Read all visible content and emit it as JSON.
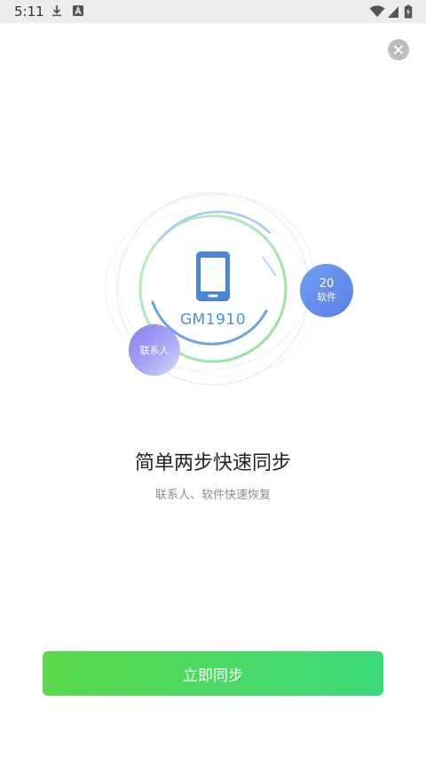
{
  "status_bar": {
    "time": "5:11",
    "left_icons": [
      "download-icon",
      "a-icon"
    ],
    "right_icons": [
      "wifi-icon",
      "signal-icon",
      "battery-charging-icon"
    ]
  },
  "close": {
    "icon": "close-icon"
  },
  "illustration": {
    "device_name": "GM1910",
    "apps_count": "20",
    "apps_label": "软件",
    "contacts_label": "联系人",
    "phone_icon": "phone-icon",
    "accent_color": "#4a90e2",
    "ring_green": "#8ee29b",
    "ring_blue": "#6ea3e8"
  },
  "content": {
    "title": "简单两步快速同步",
    "subtitle": "联系人、软件快速恢复"
  },
  "actions": {
    "sync_label": "立即同步",
    "sync_gradient_start": "#5ad94a",
    "sync_gradient_end": "#3bd97a"
  }
}
